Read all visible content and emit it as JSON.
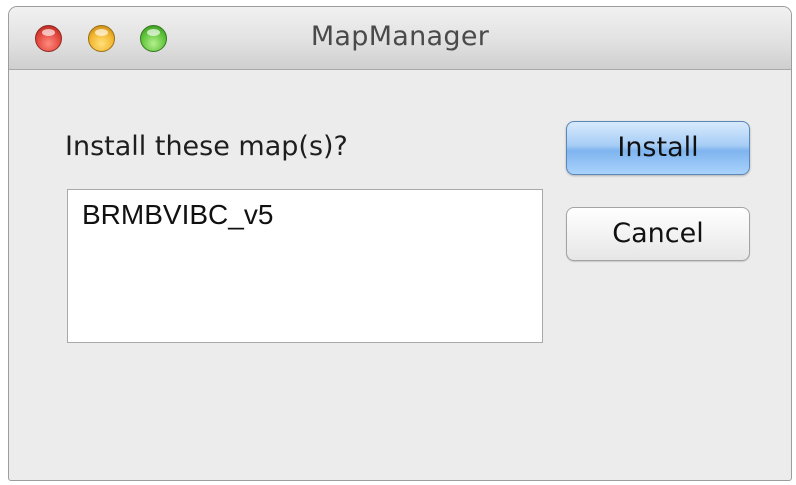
{
  "window": {
    "title": "MapManager"
  },
  "dialog": {
    "prompt": "Install these map(s)?",
    "maps": [
      "BRMBVIBC_v5"
    ],
    "install_label": "Install",
    "cancel_label": "Cancel"
  },
  "icons": {
    "close": "close-icon",
    "minimize": "minimize-icon",
    "zoom": "zoom-icon"
  },
  "colors": {
    "default_button": "#a7cdf6",
    "window_background": "#ececec",
    "close": "#e2463c",
    "minimize": "#f3b52e",
    "zoom": "#61c43c"
  }
}
